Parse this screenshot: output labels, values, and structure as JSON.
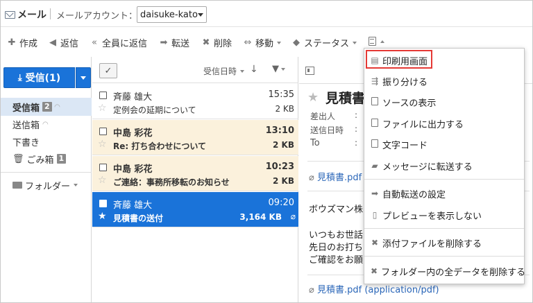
{
  "header": {
    "app_title": "メール",
    "account_label": "メールアカウント：",
    "account_value": "daisuke-kato"
  },
  "toolbar": {
    "compose": "作成",
    "reply": "返信",
    "reply_all": "全員に返信",
    "forward": "転送",
    "delete": "削除",
    "move": "移動",
    "status": "ステータス"
  },
  "sidebar": {
    "inbox_button": "受信(1)",
    "folders": [
      {
        "label": "受信箱",
        "badge": "2"
      },
      {
        "label": "送信箱",
        "badge": ""
      },
      {
        "label": "下書き",
        "badge": ""
      },
      {
        "label": "ごみ箱",
        "badge": "1"
      }
    ],
    "folder_group": "フォルダー"
  },
  "list": {
    "sort_label": "受信日時",
    "mails": [
      {
        "sender": "斉藤 雄大",
        "time": "15:35",
        "subject": "定例会の延期について",
        "size": "2 KB"
      },
      {
        "sender": "中島 彩花",
        "time": "13:10",
        "subject": "Re: 打ち合わせについて",
        "size": "2 KB"
      },
      {
        "sender": "中島 彩花",
        "time": "10:23",
        "subject": "ご連絡：事務所移転のお知らせ",
        "size": "2 KB"
      },
      {
        "sender": "斉藤 雄大",
        "time": "09:20",
        "subject": "見積書の送付",
        "size": "3,164 KB"
      }
    ]
  },
  "preview": {
    "title": "見積書の",
    "from_label": "差出人",
    "date_label": "送信日時",
    "to_label": "To",
    "colon": ":",
    "attachment_1": "見積書.pdf",
    "body_line_1": "ボウズマン株",
    "body_line_2": "いつもお世話",
    "body_line_3": "先日のお打ち",
    "body_line_4": "ご確認をお願",
    "attachment_2": "見積書.pdf (application/pdf)"
  },
  "menu": {
    "items": [
      {
        "label": "印刷用画面",
        "icon": "print-icon"
      },
      {
        "label": "振り分ける",
        "icon": "sort-icon"
      },
      {
        "label": "ソースの表示",
        "icon": "document-icon"
      },
      {
        "label": "ファイルに出力する",
        "icon": "document-icon"
      },
      {
        "label": "文字コード",
        "icon": "document-icon"
      },
      {
        "label": "メッセージに転送する",
        "icon": "message-icon"
      },
      {
        "label": "自動転送の設定",
        "icon": "arrow-right-icon"
      },
      {
        "label": "プレビューを表示しない",
        "icon": "panel-icon"
      },
      {
        "label": "添付ファイルを削除する",
        "icon": "close-icon"
      },
      {
        "label": "フォルダー内の全データを削除する",
        "icon": "close-icon"
      }
    ]
  },
  "colors": {
    "accent": "#1a73d9",
    "unread_row": "#fbf1dc",
    "highlight_box": "#e53935"
  }
}
